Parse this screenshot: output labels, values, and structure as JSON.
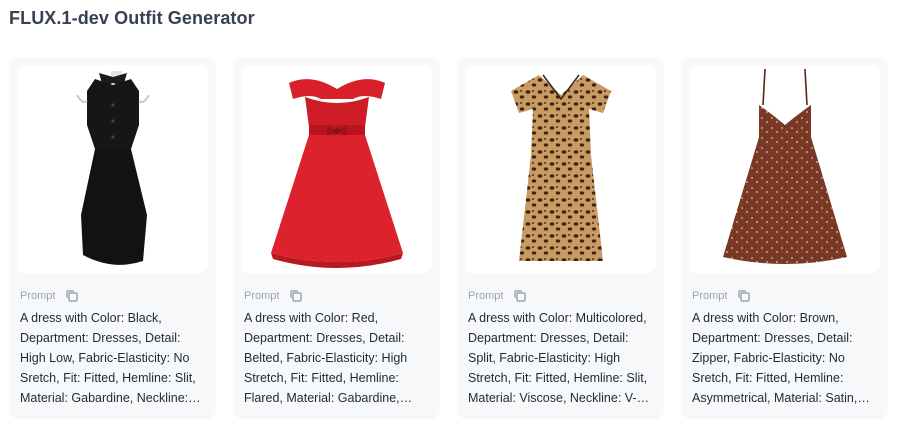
{
  "page": {
    "title": "FLUX.1-dev Outfit Generator"
  },
  "cards": [
    {
      "image_icon": "black-shirt-dress",
      "prompt_label": "Prompt",
      "prompt_text": "A dress with Color: Black, Department: Dresses, Detail: High Low, Fabric-Elasticity: No Sretch, Fit: Fitted, Hemline: Slit, Material: Gabardine, Neckline: Collared",
      "color": "#141414"
    },
    {
      "image_icon": "red-off-shoulder-dress",
      "prompt_label": "Prompt",
      "prompt_text": "A dress with Color: Red, Department: Dresses, Detail: Belted, Fabric-Elasticity: High Stretch, Fit: Fitted, Hemline: Flared, Material: Gabardine, Neckline: Off Shoulder",
      "color": "#d4202b"
    },
    {
      "image_icon": "leopard-print-dress",
      "prompt_label": "Prompt",
      "prompt_text": "A dress with Color: Multicolored, Department: Dresses, Detail: Split, Fabric-Elasticity: High Stretch, Fit: Fitted, Hemline: Slit, Material: Viscose, Neckline: V-neck",
      "color": "#c79a63"
    },
    {
      "image_icon": "brown-floral-slip-dress",
      "prompt_label": "Prompt",
      "prompt_text": "A dress with Color: Brown, Department: Dresses, Detail: Zipper, Fabric-Elasticity: No Sretch, Fit: Fitted, Hemline: Asymmetrical, Material: Satin, Neckline: V-neck",
      "color": "#7a3a26"
    }
  ]
}
